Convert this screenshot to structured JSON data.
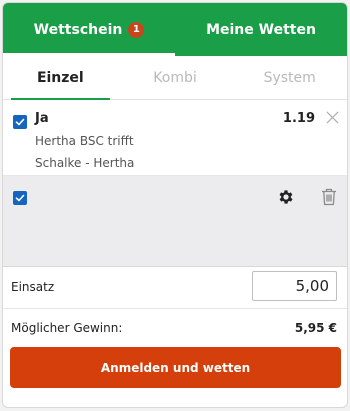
{
  "header": {
    "tabs": [
      {
        "label": "Wettschein",
        "badge": "1"
      },
      {
        "label": "Meine Wetten"
      }
    ]
  },
  "subtabs": [
    {
      "label": "Einzel"
    },
    {
      "label": "Kombi"
    },
    {
      "label": "System"
    }
  ],
  "bet": {
    "selection": "Ja",
    "odds": "1.19",
    "market": "Hertha BSC trifft",
    "match": "Schalke - Hertha"
  },
  "stake": {
    "label": "Einsatz",
    "value": "5,00"
  },
  "winnings": {
    "label": "Möglicher Gewinn:",
    "value": "5,95 €"
  },
  "submit_label": "Anmelden und wetten",
  "colors": {
    "brand_green": "#1a9e48",
    "accent_orange": "#d53f0b",
    "checkbox_blue": "#1565c0"
  },
  "icons": {
    "checkbox": "checkbox-checked-icon",
    "close": "close-icon",
    "settings": "gear-icon",
    "delete": "trash-icon"
  }
}
